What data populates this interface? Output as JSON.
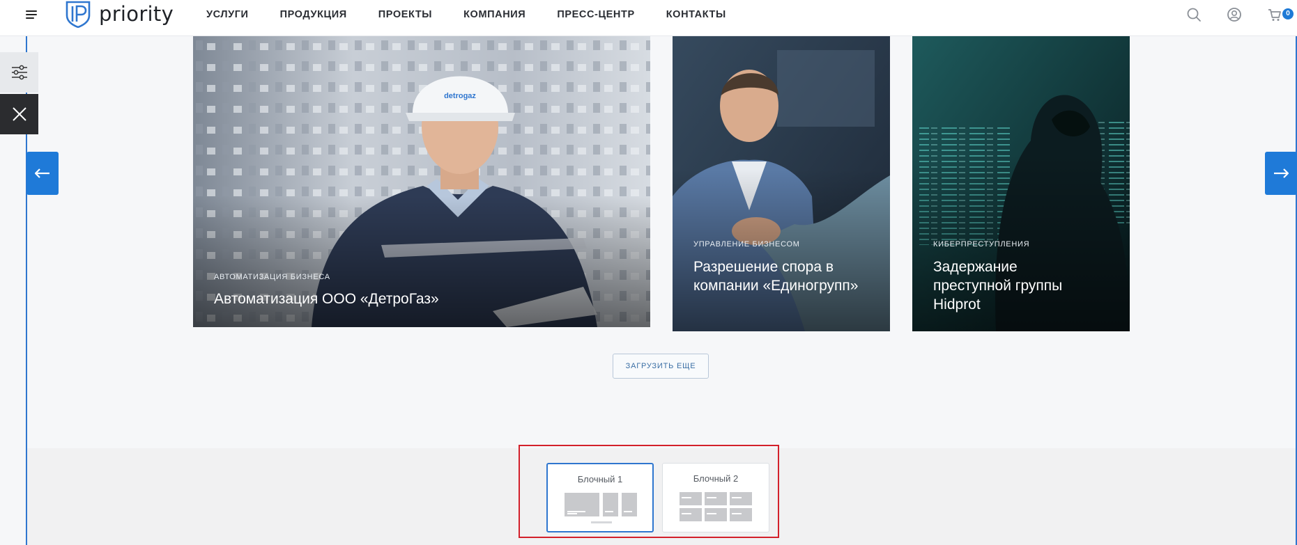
{
  "header": {
    "logo_text": "priority",
    "nav": [
      "УСЛУГИ",
      "ПРОДУКЦИЯ",
      "ПРОЕКТЫ",
      "КОМПАНИЯ",
      "ПРЕСС-ЦЕНТР",
      "КОНТАКТЫ"
    ],
    "cart_count": "0"
  },
  "icons": {
    "menu": "hamburger-icon",
    "search": "search-icon",
    "account": "user-icon",
    "cart": "cart-icon",
    "settings": "sliders-icon",
    "close": "close-icon",
    "prev": "arrow-left-icon",
    "next": "arrow-right-icon"
  },
  "colors": {
    "accent": "#1f7ad8",
    "highlight": "#d3202b",
    "dark": "#2b2c2f"
  },
  "cards": [
    {
      "category": "АВТОМАТИЗАЦИЯ БИЗНЕСА",
      "title": "Автоматизация ООО «ДетроГаз»",
      "helmet_text": "detrogaz"
    },
    {
      "category": "УПРАВЛЕНИЕ БИЗНЕСОМ",
      "title": "Разрешение спора в компании «Единогрупп»"
    },
    {
      "category": "КИБЕРПРЕСТУПЛЕНИЯ",
      "title": "Задержание преступной группы Hidprot"
    }
  ],
  "load_more": "ЗАГРУЗИТЬ ЕЩЕ",
  "layout_options": [
    {
      "label": "Блочный 1",
      "selected": true
    },
    {
      "label": "Блочный 2",
      "selected": false
    }
  ]
}
